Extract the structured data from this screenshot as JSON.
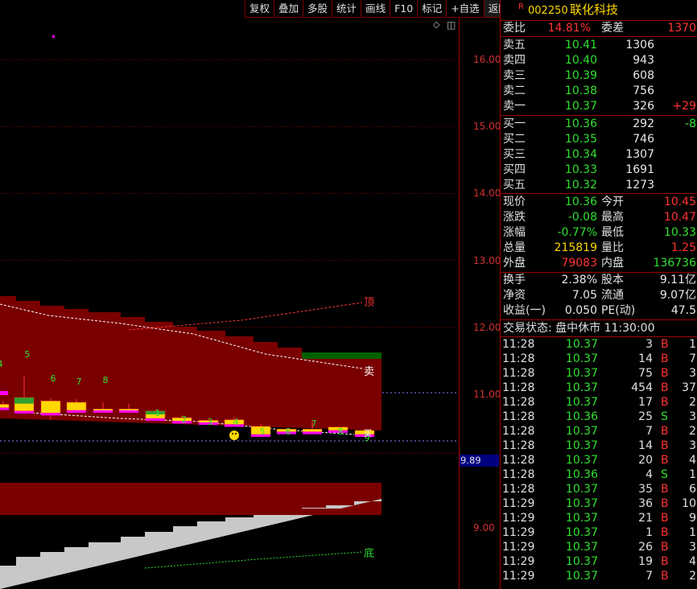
{
  "toolbar": [
    "复权",
    "叠加",
    "多股",
    "统计",
    "画线",
    "F10",
    "标记",
    "+自选",
    "返回"
  ],
  "stock": {
    "marker": "R",
    "code": "002250",
    "name": "联化科技"
  },
  "axis": {
    "ticks": [
      {
        "label": "16.00",
        "value": 16.0
      },
      {
        "label": "15.00",
        "value": 15.0
      },
      {
        "label": "14.00",
        "value": 14.0
      },
      {
        "label": "13.00",
        "value": 13.0
      },
      {
        "label": "12.00",
        "value": 12.0
      },
      {
        "label": "11.00",
        "value": 11.0
      },
      {
        "label": "9.00",
        "value": 9.0
      }
    ],
    "current_price": "9.89"
  },
  "chart_labels": {
    "top": "顶",
    "sell": "卖",
    "bottom": "底",
    "buy": "买"
  },
  "chart_data": {
    "type": "candlestick",
    "ylim": [
      8.75,
      16.35
    ],
    "candle_counts": [
      "4",
      "5",
      "6",
      "7",
      "8",
      "",
      "",
      "1",
      "2",
      "3",
      "4",
      "5",
      "6",
      "7",
      "8",
      "9"
    ],
    "candles": [
      {
        "o": 10.8,
        "c": 10.85,
        "h": 10.9,
        "l": 10.78
      },
      {
        "o": 10.75,
        "c": 10.95,
        "h": 11.28,
        "l": 10.7
      },
      {
        "o": 10.72,
        "c": 10.9,
        "h": 10.95,
        "l": 10.62
      },
      {
        "o": 10.76,
        "c": 10.88,
        "h": 10.93,
        "l": 10.72
      },
      {
        "o": 10.76,
        "c": 10.78,
        "h": 10.88,
        "l": 10.74
      },
      {
        "o": 10.76,
        "c": 10.78,
        "h": 10.86,
        "l": 10.72
      },
      {
        "o": 10.64,
        "c": 10.75,
        "h": 10.77,
        "l": 10.62
      },
      {
        "o": 10.6,
        "c": 10.65,
        "h": 10.68,
        "l": 10.58
      },
      {
        "o": 10.58,
        "c": 10.61,
        "h": 10.63,
        "l": 10.56
      },
      {
        "o": 10.55,
        "c": 10.62,
        "h": 10.66,
        "l": 10.52
      },
      {
        "o": 10.4,
        "c": 10.52,
        "h": 10.56,
        "l": 10.38
      },
      {
        "o": 10.44,
        "c": 10.48,
        "h": 10.5,
        "l": 10.42
      },
      {
        "o": 10.44,
        "c": 10.48,
        "h": 10.6,
        "l": 10.42
      },
      {
        "o": 10.46,
        "c": 10.51,
        "h": 10.52,
        "l": 10.44
      },
      {
        "o": 10.4,
        "c": 10.46,
        "h": 10.48,
        "l": 10.38
      }
    ]
  },
  "quote": {
    "weibi": {
      "label": "委比",
      "value": "14.81%",
      "label2": "委差",
      "value2": "1370"
    },
    "sell": [
      {
        "label": "卖五",
        "price": "10.41",
        "vol": "1306",
        "chg": ""
      },
      {
        "label": "卖四",
        "price": "10.40",
        "vol": "943",
        "chg": ""
      },
      {
        "label": "卖三",
        "price": "10.39",
        "vol": "608",
        "chg": ""
      },
      {
        "label": "卖二",
        "price": "10.38",
        "vol": "756",
        "chg": ""
      },
      {
        "label": "卖一",
        "price": "10.37",
        "vol": "326",
        "chg": "+29"
      }
    ],
    "buy": [
      {
        "label": "买一",
        "price": "10.36",
        "vol": "292",
        "chg": "-8"
      },
      {
        "label": "买二",
        "price": "10.35",
        "vol": "746",
        "chg": ""
      },
      {
        "label": "买三",
        "price": "10.34",
        "vol": "1307",
        "chg": ""
      },
      {
        "label": "买四",
        "price": "10.33",
        "vol": "1691",
        "chg": ""
      },
      {
        "label": "买五",
        "price": "10.32",
        "vol": "1273",
        "chg": ""
      }
    ],
    "stats1": [
      {
        "l1": "现价",
        "v1": "10.36",
        "c1": "green",
        "l2": "今开",
        "v2": "10.45",
        "c2": "red"
      },
      {
        "l1": "涨跌",
        "v1": "-0.08",
        "c1": "green",
        "l2": "最高",
        "v2": "10.47",
        "c2": "red"
      },
      {
        "l1": "涨幅",
        "v1": "-0.77%",
        "c1": "green",
        "l2": "最低",
        "v2": "10.33",
        "c2": "green"
      },
      {
        "l1": "总量",
        "v1": "215819",
        "c1": "yellow",
        "l2": "量比",
        "v2": "1.25",
        "c2": "red"
      },
      {
        "l1": "外盘",
        "v1": "79083",
        "c1": "red",
        "l2": "内盘",
        "v2": "136736",
        "c2": "green"
      }
    ],
    "stats2": [
      {
        "l1": "换手",
        "v1": "2.38%",
        "c1": "white",
        "l2": "股本",
        "v2": "9.11亿",
        "c2": "white"
      },
      {
        "l1": "净资",
        "v1": "7.05",
        "c1": "white",
        "l2": "流通",
        "v2": "9.07亿",
        "c2": "white"
      },
      {
        "l1": "收益(一)",
        "v1": "0.050",
        "c1": "white",
        "l2": "PE(动)",
        "v2": "47.5",
        "c2": "white"
      }
    ],
    "status": "交易状态: 盘中休市 11:30:00"
  },
  "ticks": [
    {
      "t": "11:28",
      "p": "10.37",
      "v": "3",
      "bs": "B",
      "n": "1"
    },
    {
      "t": "11:28",
      "p": "10.37",
      "v": "14",
      "bs": "B",
      "n": "7"
    },
    {
      "t": "11:28",
      "p": "10.37",
      "v": "75",
      "bs": "B",
      "n": "3"
    },
    {
      "t": "11:28",
      "p": "10.37",
      "v": "454",
      "bs": "B",
      "n": "37"
    },
    {
      "t": "11:28",
      "p": "10.37",
      "v": "17",
      "bs": "B",
      "n": "2"
    },
    {
      "t": "11:28",
      "p": "10.36",
      "v": "25",
      "bs": "S",
      "n": "3"
    },
    {
      "t": "11:28",
      "p": "10.37",
      "v": "7",
      "bs": "B",
      "n": "2"
    },
    {
      "t": "11:28",
      "p": "10.37",
      "v": "14",
      "bs": "B",
      "n": "3"
    },
    {
      "t": "11:28",
      "p": "10.37",
      "v": "20",
      "bs": "B",
      "n": "4"
    },
    {
      "t": "11:28",
      "p": "10.36",
      "v": "4",
      "bs": "S",
      "n": "1"
    },
    {
      "t": "11:28",
      "p": "10.37",
      "v": "35",
      "bs": "B",
      "n": "6"
    },
    {
      "t": "11:29",
      "p": "10.37",
      "v": "36",
      "bs": "B",
      "n": "10"
    },
    {
      "t": "11:29",
      "p": "10.37",
      "v": "21",
      "bs": "B",
      "n": "9"
    },
    {
      "t": "11:29",
      "p": "10.37",
      "v": "1",
      "bs": "B",
      "n": "1"
    },
    {
      "t": "11:29",
      "p": "10.37",
      "v": "26",
      "bs": "B",
      "n": "3"
    },
    {
      "t": "11:29",
      "p": "10.37",
      "v": "19",
      "bs": "B",
      "n": "4"
    },
    {
      "t": "11:29",
      "p": "10.37",
      "v": "7",
      "bs": "B",
      "n": "2"
    }
  ],
  "colors": {
    "up": "#ff3333",
    "down": "#30e030",
    "grid": "#a00000",
    "band": "#7a0000",
    "gray": "#c0c0c0",
    "yellow": "#ffd700",
    "magenta": "#ff00ff"
  }
}
